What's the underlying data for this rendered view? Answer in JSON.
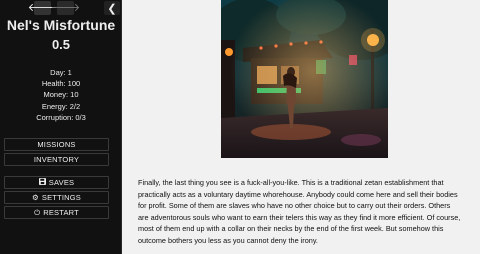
{
  "history": {
    "back_icon": "arrow-left-icon",
    "forward_icon": "arrow-right-icon",
    "collapse_icon": "chevron-left-icon"
  },
  "game": {
    "title": "Nel's Misfortune",
    "version": "0.5"
  },
  "stats": {
    "day": "Day: 1",
    "health": "Health: 100",
    "money": "Money: 10",
    "energy": "Energy: 2/2",
    "corruption": "Corruption: 0/3"
  },
  "menu": {
    "missions": "MISSIONS",
    "inventory": "INVENTORY",
    "saves": "SAVES",
    "settings": "SETTINGS",
    "restart": "RESTART"
  },
  "passage": {
    "text": "Finally, the last thing you see is a fuck-all-you-like. This is a traditional zetan establishment that practically acts as a voluntary daytime whorehouse. Anybody could come here and sell their bodies for profit. Some of them are slaves who have no other choice but to carry out their orders. Others are adventorous souls who want to earn their telers this way as they find it more efficient. Of course, most of them end up with a collar on their necks by the end of the first week. But somehow this outcome bothers you less as you cannot deny the irony."
  }
}
